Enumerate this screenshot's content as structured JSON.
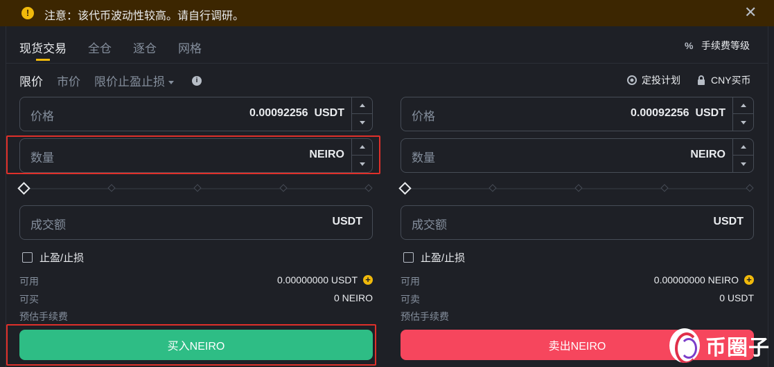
{
  "warning": {
    "text": "注意：该代币波动性较高。请自行调研。",
    "icon": "warning-icon",
    "close_icon": "close-icon"
  },
  "tabs": [
    {
      "label": "现货交易",
      "active": true
    },
    {
      "label": "全仓",
      "active": false
    },
    {
      "label": "逐仓",
      "active": false
    },
    {
      "label": "网格",
      "active": false
    }
  ],
  "fee_level": {
    "label": "手续费等级",
    "icon": "percent-icon"
  },
  "order_types": [
    {
      "label": "限价",
      "active": true
    },
    {
      "label": "市价",
      "active": false
    },
    {
      "label": "限价止盈止损",
      "active": false
    }
  ],
  "right_links": {
    "dca": {
      "label": "定投计划",
      "icon": "eye-icon"
    },
    "cny": {
      "label": "CNY买币",
      "icon": "lock-icon"
    }
  },
  "buy": {
    "price": {
      "label": "价格",
      "value": "0.00092256",
      "unit": "USDT"
    },
    "amount": {
      "label": "数量",
      "unit": "NEIRO"
    },
    "total": {
      "label": "成交额",
      "unit": "USDT"
    },
    "slider_percent": 0,
    "tpsl_label": "止盈/止损",
    "available": {
      "label": "可用",
      "value": "0.00000000 USDT"
    },
    "max": {
      "label": "可买",
      "value": "0 NEIRO"
    },
    "fee": {
      "label": "预估手续费"
    },
    "button_label": "买入NEIRO"
  },
  "sell": {
    "price": {
      "label": "价格",
      "value": "0.00092256",
      "unit": "USDT"
    },
    "amount": {
      "label": "数量",
      "unit": "NEIRO"
    },
    "total": {
      "label": "成交额",
      "unit": "USDT"
    },
    "slider_percent": 0,
    "tpsl_label": "止盈/止损",
    "available": {
      "label": "可用",
      "value": "0.00000000 NEIRO"
    },
    "max": {
      "label": "可卖",
      "value": "0 USDT"
    },
    "fee": {
      "label": "预估手续费"
    },
    "button_label": "卖出NEIRO"
  },
  "watermark": {
    "text": "币圈子"
  },
  "colors": {
    "accent": "#f0b90b",
    "buy": "#2ebd85",
    "sell": "#f6465d",
    "highlight": "#e0302a",
    "background": "#1e2026"
  }
}
